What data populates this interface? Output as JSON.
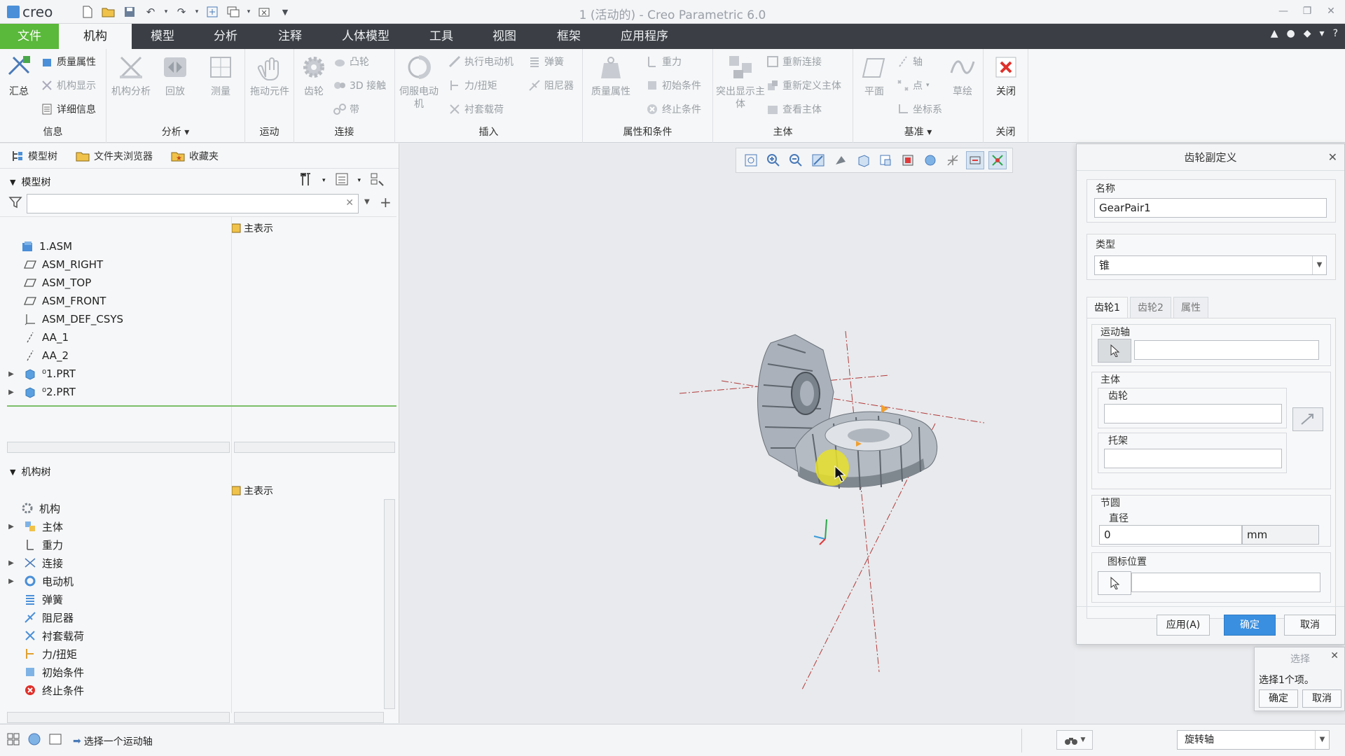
{
  "app": {
    "logo_text": "creo",
    "window_title": "1 (活动的) - Creo Parametric 6.0"
  },
  "menu": {
    "tabs": [
      "文件",
      "机构",
      "模型",
      "分析",
      "注释",
      "人体模型",
      "工具",
      "视图",
      "框架",
      "应用程序"
    ],
    "active_index": 1
  },
  "ribbon": {
    "info": {
      "label": "信息",
      "summary": "汇总",
      "mass_props": "质量属性",
      "mech_display": "机构显示",
      "details": "详细信息"
    },
    "analysis": {
      "label": "分析",
      "mech_analysis": "机构分析",
      "playback": "回放",
      "measure": "测量"
    },
    "motion": {
      "label": "运动",
      "drag": "拖动元件"
    },
    "connect": {
      "label": "连接",
      "gear": "齿轮",
      "cam": "凸轮",
      "contact3d": "3D 接触",
      "belt": "带"
    },
    "insert": {
      "label": "插入",
      "servo_motor": "伺服电动机",
      "actuator_motor": "执行电动机",
      "force_torque": "力/扭矩",
      "bushing": "衬套载荷",
      "spring": "弹簧",
      "damper": "阻尼器"
    },
    "props": {
      "label": "属性和条件",
      "mass_props": "质量属性",
      "gravity": "重力",
      "initial": "初始条件",
      "terminate": "终止条件"
    },
    "body": {
      "label": "主体",
      "highlight": "突出显示主体",
      "reconnect": "重新连接",
      "redefine": "重新定义主体",
      "view_body": "查看主体"
    },
    "datum": {
      "label": "基准",
      "plane": "平面",
      "axis": "轴",
      "point": "点",
      "csys": "坐标系",
      "sketch": "草绘"
    },
    "close": {
      "label": "关闭",
      "close": "关闭"
    }
  },
  "left_panel": {
    "nav_tabs": [
      "模型树",
      "文件夹浏览器",
      "收藏夹"
    ],
    "model_tree": {
      "header": "模型树",
      "column": "主表示",
      "items": [
        {
          "label": "1.ASM",
          "icon": "assembly-icon",
          "expandable": false,
          "indent": 0
        },
        {
          "label": "ASM_RIGHT",
          "icon": "datum-plane-icon",
          "expandable": false,
          "indent": 1
        },
        {
          "label": "ASM_TOP",
          "icon": "datum-plane-icon",
          "expandable": false,
          "indent": 1
        },
        {
          "label": "ASM_FRONT",
          "icon": "datum-plane-icon",
          "expandable": false,
          "indent": 1
        },
        {
          "label": "ASM_DEF_CSYS",
          "icon": "csys-icon",
          "expandable": false,
          "indent": 1
        },
        {
          "label": "AA_1",
          "icon": "datum-axis-icon",
          "expandable": false,
          "indent": 1
        },
        {
          "label": "AA_2",
          "icon": "datum-axis-icon",
          "expandable": false,
          "indent": 1
        },
        {
          "label": "⁰1.PRT",
          "icon": "part-icon",
          "expandable": true,
          "indent": 1
        },
        {
          "label": "⁰2.PRT",
          "icon": "part-icon",
          "expandable": true,
          "indent": 1
        }
      ]
    },
    "mech_tree": {
      "header": "机构树",
      "column": "主表示",
      "items": [
        {
          "label": "机构",
          "icon": "mechanism-icon",
          "expandable": false,
          "indent": 0
        },
        {
          "label": "主体",
          "icon": "body-icon",
          "expandable": true,
          "indent": 1
        },
        {
          "label": "重力",
          "icon": "gravity-icon",
          "expandable": false,
          "indent": 1
        },
        {
          "label": "连接",
          "icon": "connection-icon",
          "expandable": true,
          "indent": 1
        },
        {
          "label": "电动机",
          "icon": "motor-icon",
          "expandable": true,
          "indent": 1
        },
        {
          "label": "弹簧",
          "icon": "spring-icon",
          "expandable": false,
          "indent": 1
        },
        {
          "label": "阻尼器",
          "icon": "damper-icon",
          "expandable": false,
          "indent": 1
        },
        {
          "label": "衬套载荷",
          "icon": "bushing-icon",
          "expandable": false,
          "indent": 1
        },
        {
          "label": "力/扭矩",
          "icon": "force-icon",
          "expandable": false,
          "indent": 1
        },
        {
          "label": "初始条件",
          "icon": "initial-condition-icon",
          "expandable": false,
          "indent": 1
        },
        {
          "label": "终止条件",
          "icon": "terminate-icon",
          "expandable": false,
          "indent": 1
        }
      ]
    }
  },
  "dialog": {
    "title": "齿轮副定义",
    "name_label": "名称",
    "name_value": "GearPair1",
    "type_label": "类型",
    "type_value": "锥",
    "tabs": [
      "齿轮1",
      "齿轮2",
      "属性"
    ],
    "active_tab": 0,
    "motion_axis_label": "运动轴",
    "body_label": "主体",
    "gear_label": "齿轮",
    "carrier_label": "托架",
    "pitch_circle_label": "节圆",
    "diameter_label": "直径",
    "diameter_value": "0",
    "diameter_unit": "mm",
    "icon_pos_label": "图标位置",
    "apply": "应用(A)",
    "ok": "确定",
    "cancel": "取消"
  },
  "select_popup": {
    "title": "选择",
    "message": "选择1个项。",
    "ok": "确定",
    "cancel": "取消"
  },
  "status": {
    "message": "选择一个运动轴",
    "filter_value": "旋转轴"
  },
  "colors": {
    "menu_bg": "#3b3f45",
    "file_tab": "#5ab83a",
    "primary_button": "#3a8fe0",
    "highlight": "#e6e02a"
  }
}
